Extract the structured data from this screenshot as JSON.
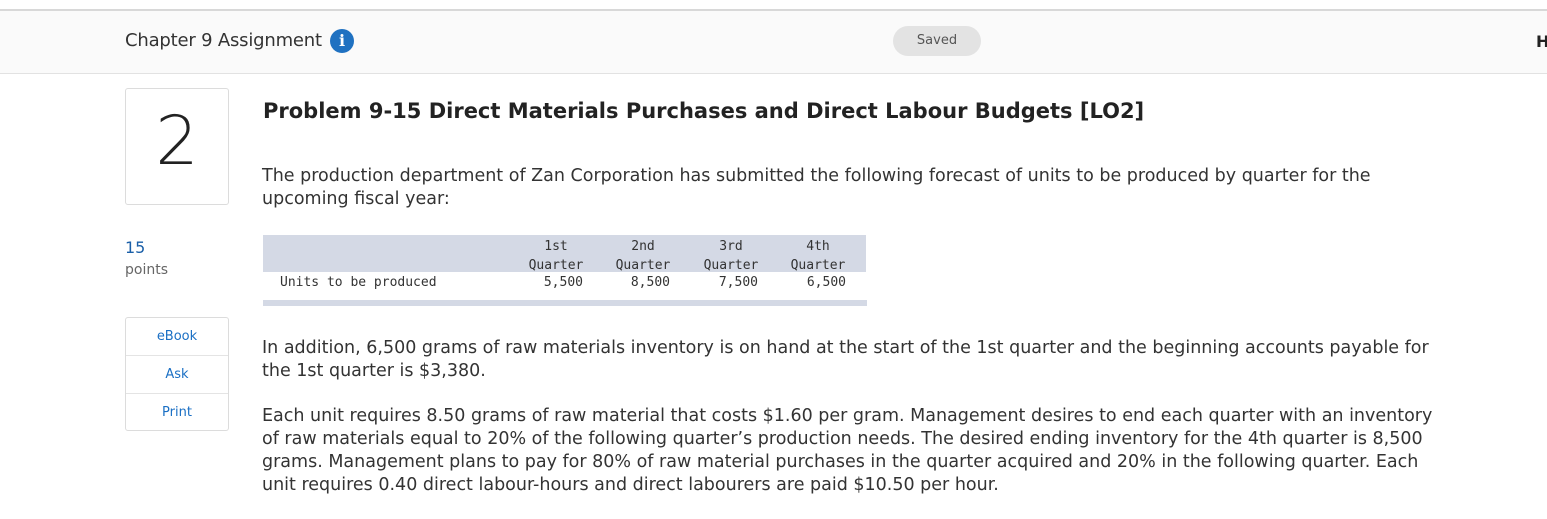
{
  "header": {
    "assignment_title": "Chapter 9 Assignment",
    "info_icon": "i",
    "saved_label": "Saved",
    "right_text": "H"
  },
  "question": {
    "number": "2",
    "points_value": "15",
    "points_label": "points"
  },
  "tools": {
    "ebook": "eBook",
    "ask": "Ask",
    "print": "Print"
  },
  "problem": {
    "title": "Problem 9-15 Direct Materials Purchases and Direct Labour Budgets [LO2]",
    "intro": "The production department of Zan Corporation has submitted the following forecast of units to be produced by quarter for the upcoming fiscal year:",
    "paragraph2": "In addition, 6,500 grams of raw materials inventory is on hand at the start of the 1st quarter and the beginning accounts payable for the 1st quarter is $3,380.",
    "paragraph3": "Each unit requires 8.50 grams of raw material that costs $1.60 per gram. Management desires to end each quarter with an inventory of raw materials equal to 20% of the following quarter’s production needs. The desired ending inventory for the 4th quarter is 8,500 grams. Management plans to pay for 80% of raw material purchases in the quarter acquired and 20% in the following quarter. Each unit requires 0.40 direct labour-hours and direct labourers are paid $10.50 per hour."
  },
  "table": {
    "columns": [
      {
        "line1": "1st",
        "line2": "Quarter"
      },
      {
        "line1": "2nd",
        "line2": "Quarter"
      },
      {
        "line1": "3rd",
        "line2": "Quarter"
      },
      {
        "line1": "4th",
        "line2": "Quarter"
      }
    ],
    "row_label": "Units to be produced",
    "values": [
      "5,500",
      "8,500",
      "7,500",
      "6,500"
    ]
  },
  "colors": {
    "info_icon": "#1f71c1",
    "link": "#1a6fc4",
    "table_header_bg": "#d4d9e5"
  }
}
